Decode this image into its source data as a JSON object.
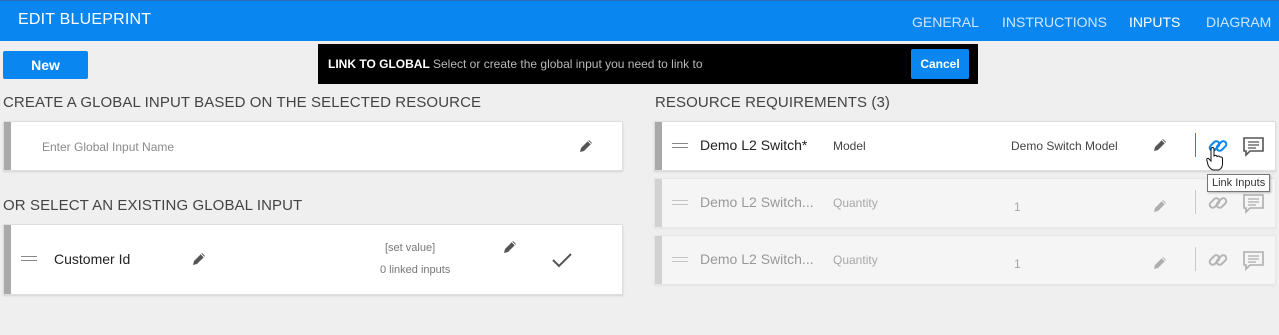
{
  "header": {
    "title": "EDIT BLUEPRINT",
    "tabs": [
      {
        "label": "GENERAL",
        "active": false
      },
      {
        "label": "INSTRUCTIONS",
        "active": false
      },
      {
        "label": "INPUTS",
        "active": true
      },
      {
        "label": "DIAGRAM",
        "active": false
      }
    ]
  },
  "toolbar": {
    "new_label": "New"
  },
  "link_banner": {
    "title": "LINK TO GLOBAL",
    "text": "Select or create the global input you need to link to",
    "cancel_label": "Cancel"
  },
  "create_section": {
    "title": "CREATE A GLOBAL INPUT BASED ON THE SELECTED RESOURCE",
    "placeholder": "Enter Global Input Name",
    "edit_icon": "pencil-icon"
  },
  "existing_section": {
    "title": "OR SELECT AN EXISTING GLOBAL INPUT",
    "inputs": [
      {
        "name": "Customer Id",
        "value": "[set value]",
        "linked": "0 linked inputs",
        "icons": [
          "drag-handle-icon",
          "pencil-icon",
          "checkmark-icon"
        ]
      }
    ]
  },
  "requirements": {
    "title": "RESOURCE REQUIREMENTS (3)",
    "rows": [
      {
        "name": "Demo L2 Switch*",
        "attribute": "Model",
        "value": "Demo Switch Model",
        "active": true
      },
      {
        "name": "Demo L2 Switch...",
        "attribute": "Quantity",
        "value": "1",
        "active": false
      },
      {
        "name": "Demo L2 Switch...",
        "attribute": "Quantity",
        "value": "1",
        "active": false
      }
    ],
    "row_icons": [
      "drag-handle-icon",
      "pencil-icon",
      "link-icon",
      "comment-icon"
    ]
  },
  "tooltip": {
    "text": "Link Inputs"
  },
  "colors": {
    "accent": "#0a86f0",
    "banner": "#000000",
    "background": "#efefef",
    "card_bar": "#a9a9a9"
  }
}
